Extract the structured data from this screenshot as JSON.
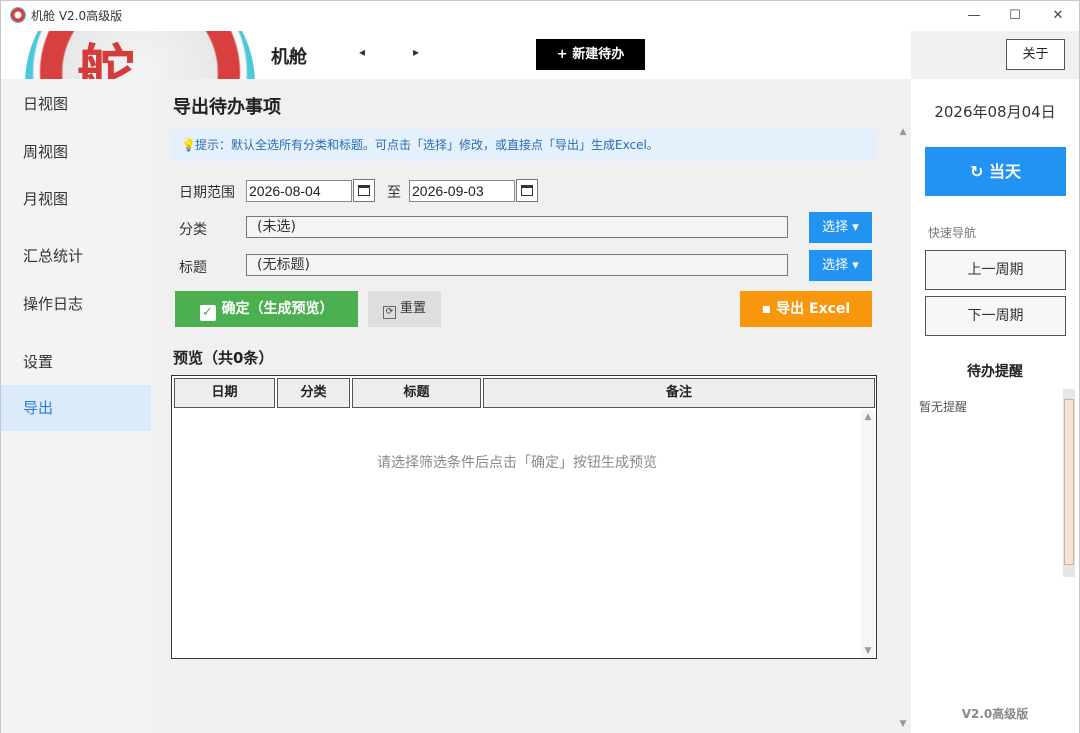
{
  "window": {
    "title": "机舱 V2.0高级版",
    "minimize": "—",
    "maximize": "☐",
    "close": "✕"
  },
  "header": {
    "logo_text": "舵",
    "brand": "机舱",
    "prev_arrow": "◂",
    "next_arrow": "▸",
    "new_todo": "+ 新建待办",
    "about": "关于"
  },
  "sidebar": {
    "items": [
      {
        "label": "日视图"
      },
      {
        "label": "周视图"
      },
      {
        "label": "月视图"
      },
      {
        "label": "汇总统计"
      },
      {
        "label": "操作日志"
      },
      {
        "label": "设置"
      },
      {
        "label": "导出"
      }
    ],
    "active_index": 6
  },
  "main": {
    "title": "导出待办事项",
    "hint": "提示：默认全选所有分类和标题。可点击「选择」修改，或直接点「导出」生成Excel。",
    "date_range_label": "日期范围",
    "date_from": "2026-08-04",
    "date_to_label": "至",
    "date_to": "2026-09-03",
    "category_label": "分类",
    "category_value": "(未选)",
    "title_label": "标题",
    "title_value": "(无标题)",
    "select_button": "选择 ▾",
    "confirm_button": "确定（生成预览）",
    "reset_button": "重置",
    "export_button": "导出 Excel",
    "preview_title": "预览（共0条）",
    "table": {
      "columns": [
        "日期",
        "分类",
        "标题",
        "备注"
      ],
      "rows": [],
      "empty_message": "请选择筛选条件后点击「确定」按钮生成预览"
    }
  },
  "right_panel": {
    "date": "2026年08月04日",
    "today_button": "当天",
    "quick_nav_label": "快速导航",
    "prev_week": "上一周期",
    "next_week": "下一周期",
    "reminder_title": "待办提醒",
    "no_reminder": "暂无提醒",
    "version": "V2.0高级版"
  },
  "colors": {
    "primary_blue": "#2293f0",
    "confirm_green": "#4caf50",
    "export_orange": "#f8960e",
    "active_bg": "#dbeaf8",
    "hint_bg": "#e4f0fb"
  }
}
